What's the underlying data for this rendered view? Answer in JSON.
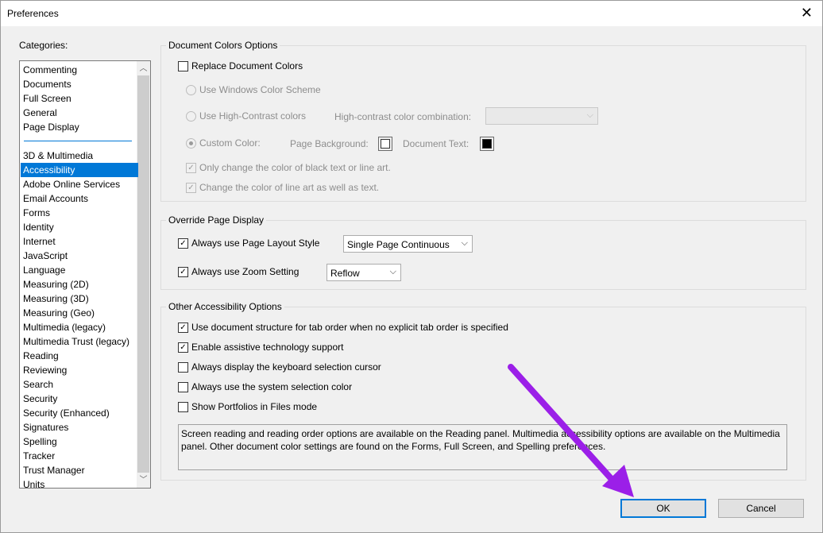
{
  "window": {
    "title": "Preferences",
    "close_glyph": "✕"
  },
  "categories": {
    "label": "Categories:",
    "top_items": [
      "Commenting",
      "Documents",
      "Full Screen",
      "General",
      "Page Display"
    ],
    "items": [
      "3D & Multimedia",
      "Accessibility",
      "Adobe Online Services",
      "Email Accounts",
      "Forms",
      "Identity",
      "Internet",
      "JavaScript",
      "Language",
      "Measuring (2D)",
      "Measuring (3D)",
      "Measuring (Geo)",
      "Multimedia (legacy)",
      "Multimedia Trust (legacy)",
      "Reading",
      "Reviewing",
      "Search",
      "Security",
      "Security (Enhanced)",
      "Signatures",
      "Spelling",
      "Tracker",
      "Trust Manager",
      "Units"
    ],
    "selected": "Accessibility"
  },
  "doc_colors": {
    "title": "Document Colors Options",
    "replace_label": "Replace Document Colors",
    "replace_checked": false,
    "windows_scheme_label": "Use Windows Color Scheme",
    "high_contrast_label": "Use High-Contrast colors",
    "high_contrast_combo_label": "High-contrast color combination:",
    "custom_color_label": "Custom Color:",
    "page_background_label": "Page Background:",
    "page_background_color": "#ffffff",
    "document_text_label": "Document Text:",
    "document_text_color": "#000000",
    "only_change_black_label": "Only change the color of black text or line art.",
    "change_line_art_label": "Change the color of line art as well as text."
  },
  "override": {
    "title": "Override Page Display",
    "page_layout_label": "Always use Page Layout Style",
    "page_layout_checked": true,
    "page_layout_value": "Single Page Continuous",
    "zoom_label": "Always use Zoom Setting",
    "zoom_checked": true,
    "zoom_value": "Reflow"
  },
  "other": {
    "title": "Other Accessibility Options",
    "options": [
      {
        "label": "Use document structure for tab order when no explicit tab order is specified",
        "checked": true
      },
      {
        "label": "Enable assistive technology support",
        "checked": true
      },
      {
        "label": "Always display the keyboard selection cursor",
        "checked": false
      },
      {
        "label": "Always use the system selection color",
        "checked": false
      },
      {
        "label": "Show Portfolios in Files mode",
        "checked": false
      }
    ],
    "info_text": "Screen reading and reading order options are available on the Reading panel. Multimedia accessibility options are available on the Multimedia panel. Other document color settings are found on the Forms, Full Screen, and Spelling preferences."
  },
  "buttons": {
    "ok": "OK",
    "cancel": "Cancel"
  },
  "colors": {
    "selection": "#0078d7",
    "annotation_arrow": "#9b1fe8"
  }
}
